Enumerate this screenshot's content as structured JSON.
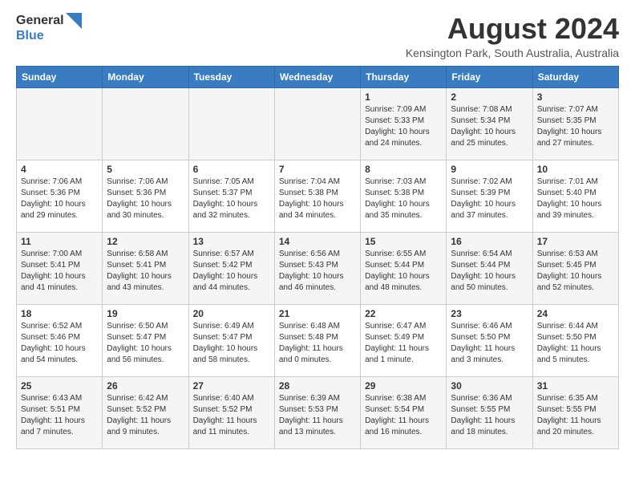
{
  "header": {
    "logo_line1": "General",
    "logo_line2": "Blue",
    "month_year": "August 2024",
    "location": "Kensington Park, South Australia, Australia"
  },
  "weekdays": [
    "Sunday",
    "Monday",
    "Tuesday",
    "Wednesday",
    "Thursday",
    "Friday",
    "Saturday"
  ],
  "weeks": [
    [
      {
        "day": "",
        "sunrise": "",
        "sunset": "",
        "daylight": ""
      },
      {
        "day": "",
        "sunrise": "",
        "sunset": "",
        "daylight": ""
      },
      {
        "day": "",
        "sunrise": "",
        "sunset": "",
        "daylight": ""
      },
      {
        "day": "",
        "sunrise": "",
        "sunset": "",
        "daylight": ""
      },
      {
        "day": "1",
        "sunrise": "Sunrise: 7:09 AM",
        "sunset": "Sunset: 5:33 PM",
        "daylight": "Daylight: 10 hours and 24 minutes."
      },
      {
        "day": "2",
        "sunrise": "Sunrise: 7:08 AM",
        "sunset": "Sunset: 5:34 PM",
        "daylight": "Daylight: 10 hours and 25 minutes."
      },
      {
        "day": "3",
        "sunrise": "Sunrise: 7:07 AM",
        "sunset": "Sunset: 5:35 PM",
        "daylight": "Daylight: 10 hours and 27 minutes."
      }
    ],
    [
      {
        "day": "4",
        "sunrise": "Sunrise: 7:06 AM",
        "sunset": "Sunset: 5:36 PM",
        "daylight": "Daylight: 10 hours and 29 minutes."
      },
      {
        "day": "5",
        "sunrise": "Sunrise: 7:06 AM",
        "sunset": "Sunset: 5:36 PM",
        "daylight": "Daylight: 10 hours and 30 minutes."
      },
      {
        "day": "6",
        "sunrise": "Sunrise: 7:05 AM",
        "sunset": "Sunset: 5:37 PM",
        "daylight": "Daylight: 10 hours and 32 minutes."
      },
      {
        "day": "7",
        "sunrise": "Sunrise: 7:04 AM",
        "sunset": "Sunset: 5:38 PM",
        "daylight": "Daylight: 10 hours and 34 minutes."
      },
      {
        "day": "8",
        "sunrise": "Sunrise: 7:03 AM",
        "sunset": "Sunset: 5:38 PM",
        "daylight": "Daylight: 10 hours and 35 minutes."
      },
      {
        "day": "9",
        "sunrise": "Sunrise: 7:02 AM",
        "sunset": "Sunset: 5:39 PM",
        "daylight": "Daylight: 10 hours and 37 minutes."
      },
      {
        "day": "10",
        "sunrise": "Sunrise: 7:01 AM",
        "sunset": "Sunset: 5:40 PM",
        "daylight": "Daylight: 10 hours and 39 minutes."
      }
    ],
    [
      {
        "day": "11",
        "sunrise": "Sunrise: 7:00 AM",
        "sunset": "Sunset: 5:41 PM",
        "daylight": "Daylight: 10 hours and 41 minutes."
      },
      {
        "day": "12",
        "sunrise": "Sunrise: 6:58 AM",
        "sunset": "Sunset: 5:41 PM",
        "daylight": "Daylight: 10 hours and 43 minutes."
      },
      {
        "day": "13",
        "sunrise": "Sunrise: 6:57 AM",
        "sunset": "Sunset: 5:42 PM",
        "daylight": "Daylight: 10 hours and 44 minutes."
      },
      {
        "day": "14",
        "sunrise": "Sunrise: 6:56 AM",
        "sunset": "Sunset: 5:43 PM",
        "daylight": "Daylight: 10 hours and 46 minutes."
      },
      {
        "day": "15",
        "sunrise": "Sunrise: 6:55 AM",
        "sunset": "Sunset: 5:44 PM",
        "daylight": "Daylight: 10 hours and 48 minutes."
      },
      {
        "day": "16",
        "sunrise": "Sunrise: 6:54 AM",
        "sunset": "Sunset: 5:44 PM",
        "daylight": "Daylight: 10 hours and 50 minutes."
      },
      {
        "day": "17",
        "sunrise": "Sunrise: 6:53 AM",
        "sunset": "Sunset: 5:45 PM",
        "daylight": "Daylight: 10 hours and 52 minutes."
      }
    ],
    [
      {
        "day": "18",
        "sunrise": "Sunrise: 6:52 AM",
        "sunset": "Sunset: 5:46 PM",
        "daylight": "Daylight: 10 hours and 54 minutes."
      },
      {
        "day": "19",
        "sunrise": "Sunrise: 6:50 AM",
        "sunset": "Sunset: 5:47 PM",
        "daylight": "Daylight: 10 hours and 56 minutes."
      },
      {
        "day": "20",
        "sunrise": "Sunrise: 6:49 AM",
        "sunset": "Sunset: 5:47 PM",
        "daylight": "Daylight: 10 hours and 58 minutes."
      },
      {
        "day": "21",
        "sunrise": "Sunrise: 6:48 AM",
        "sunset": "Sunset: 5:48 PM",
        "daylight": "Daylight: 11 hours and 0 minutes."
      },
      {
        "day": "22",
        "sunrise": "Sunrise: 6:47 AM",
        "sunset": "Sunset: 5:49 PM",
        "daylight": "Daylight: 11 hours and 1 minute."
      },
      {
        "day": "23",
        "sunrise": "Sunrise: 6:46 AM",
        "sunset": "Sunset: 5:50 PM",
        "daylight": "Daylight: 11 hours and 3 minutes."
      },
      {
        "day": "24",
        "sunrise": "Sunrise: 6:44 AM",
        "sunset": "Sunset: 5:50 PM",
        "daylight": "Daylight: 11 hours and 5 minutes."
      }
    ],
    [
      {
        "day": "25",
        "sunrise": "Sunrise: 6:43 AM",
        "sunset": "Sunset: 5:51 PM",
        "daylight": "Daylight: 11 hours and 7 minutes."
      },
      {
        "day": "26",
        "sunrise": "Sunrise: 6:42 AM",
        "sunset": "Sunset: 5:52 PM",
        "daylight": "Daylight: 11 hours and 9 minutes."
      },
      {
        "day": "27",
        "sunrise": "Sunrise: 6:40 AM",
        "sunset": "Sunset: 5:52 PM",
        "daylight": "Daylight: 11 hours and 11 minutes."
      },
      {
        "day": "28",
        "sunrise": "Sunrise: 6:39 AM",
        "sunset": "Sunset: 5:53 PM",
        "daylight": "Daylight: 11 hours and 13 minutes."
      },
      {
        "day": "29",
        "sunrise": "Sunrise: 6:38 AM",
        "sunset": "Sunset: 5:54 PM",
        "daylight": "Daylight: 11 hours and 16 minutes."
      },
      {
        "day": "30",
        "sunrise": "Sunrise: 6:36 AM",
        "sunset": "Sunset: 5:55 PM",
        "daylight": "Daylight: 11 hours and 18 minutes."
      },
      {
        "day": "31",
        "sunrise": "Sunrise: 6:35 AM",
        "sunset": "Sunset: 5:55 PM",
        "daylight": "Daylight: 11 hours and 20 minutes."
      }
    ]
  ]
}
